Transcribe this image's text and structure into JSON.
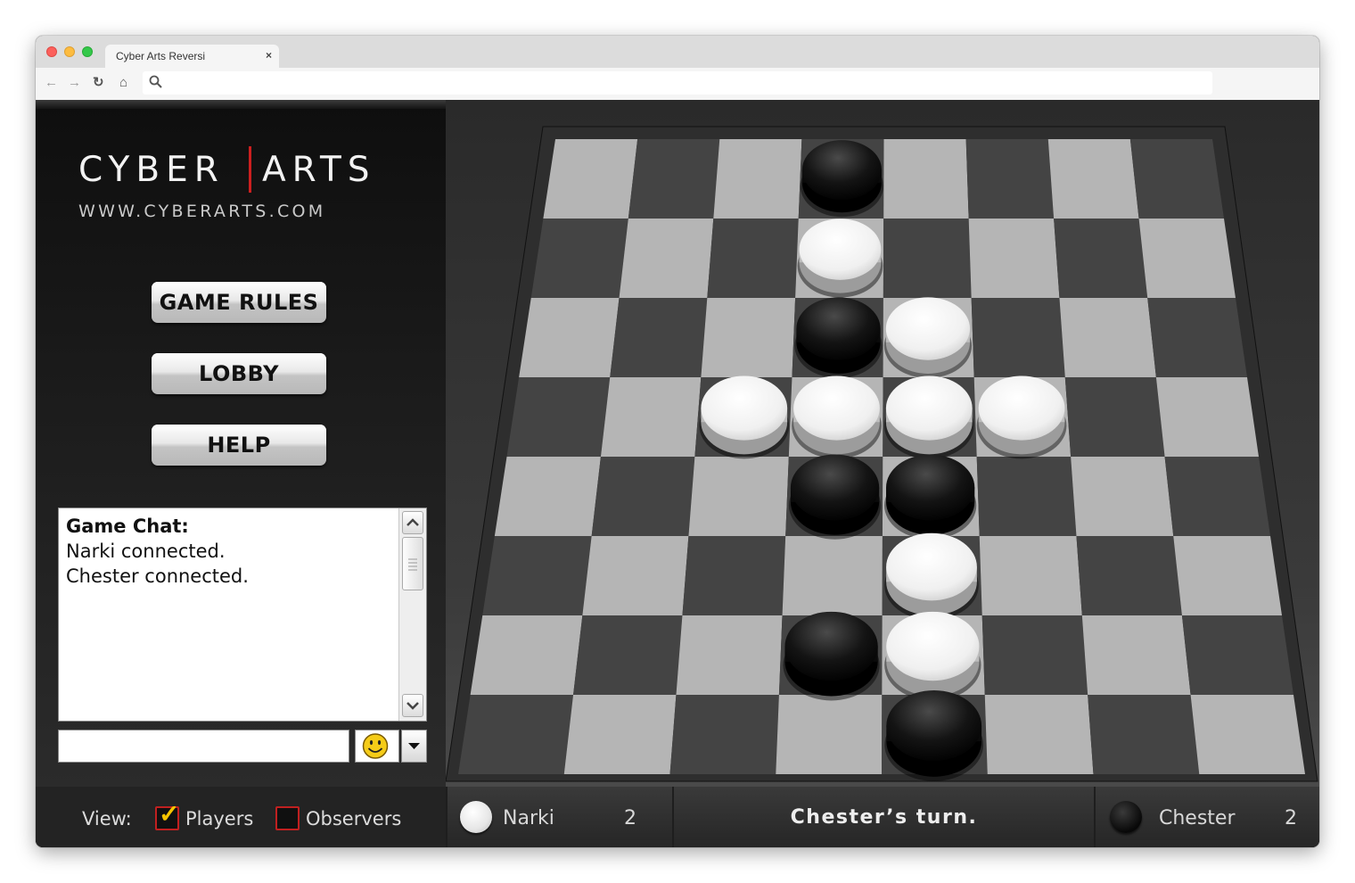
{
  "browser": {
    "tab_title": "Cyber Arts Reversi",
    "tab_close": "×",
    "url": ""
  },
  "logo": {
    "brand_left": "CYBER",
    "brand_right": "ARTS",
    "website": "WWW.CYBERARTS.COM"
  },
  "menu": {
    "game_rules": "GAME RULES",
    "lobby": "LOBBY",
    "help": "HELP"
  },
  "chat": {
    "title": "Game Chat:",
    "messages": [
      "Narki connected.",
      "Chester connected."
    ],
    "input_value": ""
  },
  "view": {
    "label": "View:",
    "players_label": "Players",
    "players_checked": true,
    "observers_label": "Observers",
    "observers_checked": false
  },
  "players": {
    "white": {
      "name": "Narki",
      "score": "2"
    },
    "black": {
      "name": "Chester",
      "score": "2"
    },
    "status": "Chester’s turn."
  },
  "board": {
    "size": 8,
    "discs": [
      {
        "row": 0,
        "col": 3,
        "color": "black"
      },
      {
        "row": 1,
        "col": 3,
        "color": "white"
      },
      {
        "row": 2,
        "col": 3,
        "color": "black"
      },
      {
        "row": 2,
        "col": 4,
        "color": "white"
      },
      {
        "row": 3,
        "col": 2,
        "color": "white"
      },
      {
        "row": 3,
        "col": 3,
        "color": "white"
      },
      {
        "row": 3,
        "col": 4,
        "color": "white"
      },
      {
        "row": 3,
        "col": 5,
        "color": "white"
      },
      {
        "row": 4,
        "col": 3,
        "color": "black"
      },
      {
        "row": 4,
        "col": 4,
        "color": "black"
      },
      {
        "row": 5,
        "col": 4,
        "color": "white"
      },
      {
        "row": 6,
        "col": 3,
        "color": "black"
      },
      {
        "row": 6,
        "col": 4,
        "color": "white"
      },
      {
        "row": 7,
        "col": 4,
        "color": "black"
      }
    ],
    "colors": {
      "light_square": "#b5b5b5",
      "dark_square": "#444444",
      "frame": "#2e2e2e"
    }
  }
}
